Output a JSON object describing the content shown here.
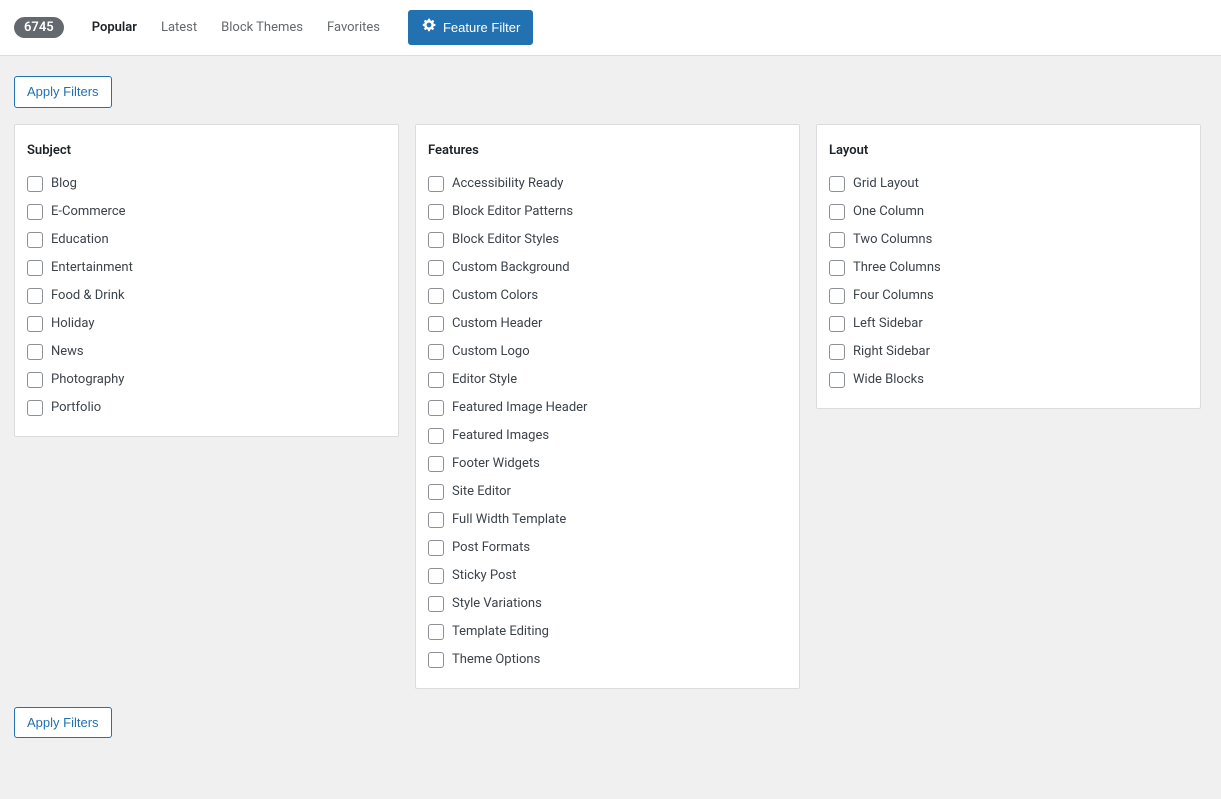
{
  "header": {
    "count_badge": "6745",
    "tabs": [
      {
        "label": "Popular",
        "active": true
      },
      {
        "label": "Latest",
        "active": false
      },
      {
        "label": "Block Themes",
        "active": false
      },
      {
        "label": "Favorites",
        "active": false
      }
    ],
    "feature_filter_label": "Feature Filter"
  },
  "apply_button_label": "Apply Filters",
  "filter_groups": {
    "subject": {
      "title": "Subject",
      "options": [
        "Blog",
        "E-Commerce",
        "Education",
        "Entertainment",
        "Food & Drink",
        "Holiday",
        "News",
        "Photography",
        "Portfolio"
      ]
    },
    "features": {
      "title": "Features",
      "options": [
        "Accessibility Ready",
        "Block Editor Patterns",
        "Block Editor Styles",
        "Custom Background",
        "Custom Colors",
        "Custom Header",
        "Custom Logo",
        "Editor Style",
        "Featured Image Header",
        "Featured Images",
        "Footer Widgets",
        "Site Editor",
        "Full Width Template",
        "Post Formats",
        "Sticky Post",
        "Style Variations",
        "Template Editing",
        "Theme Options"
      ]
    },
    "layout": {
      "title": "Layout",
      "options": [
        "Grid Layout",
        "One Column",
        "Two Columns",
        "Three Columns",
        "Four Columns",
        "Left Sidebar",
        "Right Sidebar",
        "Wide Blocks"
      ]
    }
  }
}
